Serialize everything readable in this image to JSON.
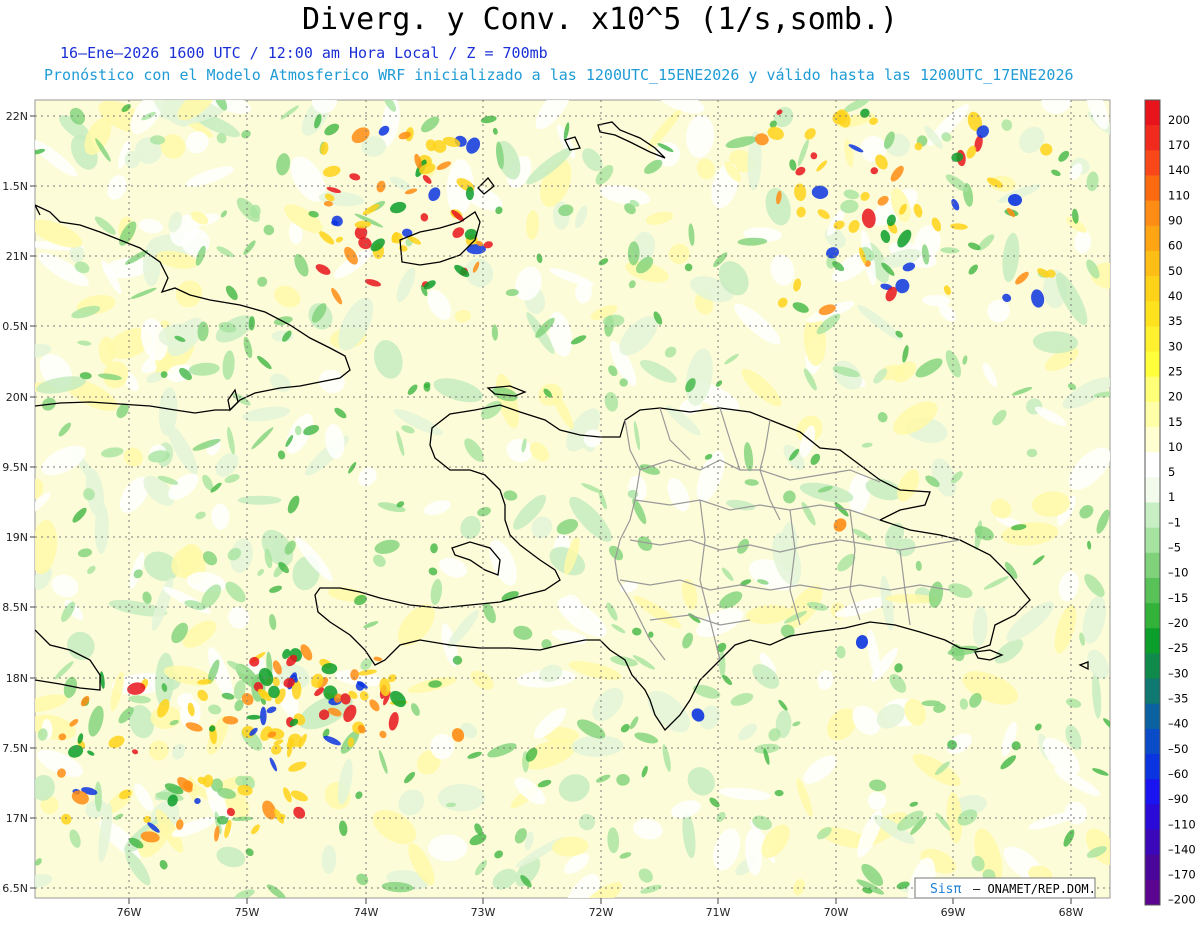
{
  "header": {
    "title": "Diverg. y Conv. x10^5 (1/s,somb.)",
    "subtitle_time": "16–Ene–2026  1600 UTC / 12:00 am Hora Local / Z = 700mb",
    "subtitle_model": "Pronóstico con el Modelo Atmosferico WRF inicializado a las 1200UTC_15ENE2026 y válido hasta las  1200UTC_17ENE2026"
  },
  "axes": {
    "lat_labels": [
      "22N",
      "1.5N",
      "21N",
      "0.5N",
      "20N",
      "9.5N",
      "19N",
      "8.5N",
      "18N",
      "7.5N",
      "17N",
      "6.5N"
    ],
    "lon_labels": [
      "76W",
      "75W",
      "74W",
      "73W",
      "72W",
      "71W",
      "70W",
      "69W",
      "68W"
    ]
  },
  "colorbar": {
    "levels": [
      "200",
      "170",
      "140",
      "110",
      "90",
      "60",
      "50",
      "40",
      "35",
      "30",
      "25",
      "20",
      "15",
      "10",
      "5",
      "1",
      "–1",
      "–5",
      "–10",
      "–15",
      "–20",
      "–25",
      "–30",
      "–35",
      "–40",
      "–50",
      "–60",
      "–90",
      "–110",
      "–140",
      "–170",
      "–200"
    ],
    "colors": [
      "#e8141c",
      "#f02a1c",
      "#f8481a",
      "#fc6a10",
      "#ff8c14",
      "#ffa514",
      "#ffbe16",
      "#ffd21a",
      "#ffe21e",
      "#fff030",
      "#ffff3c",
      "#ffff78",
      "#ffffa8",
      "#ffffd2",
      "#ffffff",
      "#f2fbec",
      "#c8efc4",
      "#a6e3a0",
      "#7fd27a",
      "#58c258",
      "#33b23a",
      "#0c9e2a",
      "#108a4a",
      "#0f7870",
      "#0a62a0",
      "#0a4cc8",
      "#0a34e0",
      "#1a14f0",
      "#2a0ad6",
      "#3a08b8",
      "#4a069a",
      "#5a0490"
    ]
  },
  "credit": {
    "logo_text": "Sisπ",
    "org_text": "– ONAMET/REP.DOM."
  }
}
